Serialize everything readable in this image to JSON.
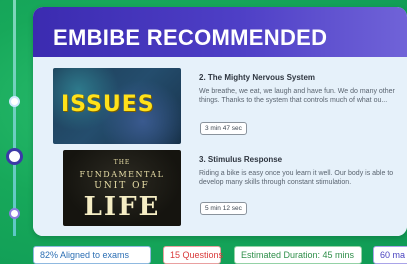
{
  "recommended": {
    "title": "EMBIBE RECOMMENDED",
    "items": [
      {
        "title": "2. The Mighty Nervous System",
        "description": "We breathe, we eat, we laugh and have fun. We do many other things. Thanks to the system that controls much of what ou...",
        "duration": "3 min 47 sec",
        "thumbnail_text": "ISSUES"
      },
      {
        "title": "3. Stimulus Response",
        "description": "Riding a bike is easy once you learn it well. Our body is able to develop many skills through constant stimulation.",
        "duration": "5 min 12 sec",
        "thumbnail_text_small": "THE",
        "thumbnail_text_mid": "FUNDAMENTAL",
        "thumbnail_text_sub": "UNIT OF",
        "thumbnail_text_big": "LIFE"
      }
    ]
  },
  "tags": {
    "aligned": "82% Aligned to exams",
    "questions": "15 Questions",
    "estimated": "Estimated Duration: 45 mins",
    "marks": "60 ma"
  },
  "colors": {
    "background": "#17a85a",
    "header": "#4e3fc6",
    "card_body": "#e6f1fa"
  }
}
